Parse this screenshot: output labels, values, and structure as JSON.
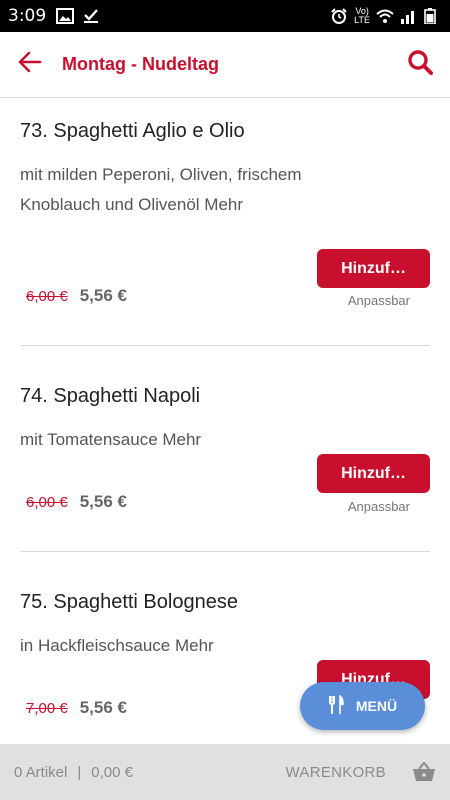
{
  "status": {
    "time": "3:09",
    "volte": "Vo)",
    "lte": "LTE"
  },
  "header": {
    "title": "Montag - Nudeltag"
  },
  "items": [
    {
      "name": "73. Spaghetti Aglio e Olio",
      "description": "mit milden Peperoni, Oliven, frischem Knoblauch und Olivenöl Mehr",
      "old_price": "6,00 €",
      "price": "5,56 €",
      "button": "Hinzuf…",
      "note": "Anpassbar"
    },
    {
      "name": "74. Spaghetti Napoli",
      "description": "mit Tomatensauce Mehr",
      "old_price": "6,00 €",
      "price": "5,56 €",
      "button": "Hinzuf…",
      "note": "Anpassbar"
    },
    {
      "name": "75. Spaghetti Bolognese",
      "description": "in Hackfleischsauce Mehr",
      "old_price": "7,00 €",
      "price": "5,56 €",
      "button": "Hinzuf…"
    }
  ],
  "fab": {
    "label": "MENÜ"
  },
  "cart": {
    "count": "0 Artikel",
    "separator": "|",
    "total": "0,00 €",
    "label": "WARENKORB"
  },
  "colors": {
    "accent": "#c8102e",
    "fab": "#5b8ed8",
    "cart_bar": "#e0e0e0"
  }
}
